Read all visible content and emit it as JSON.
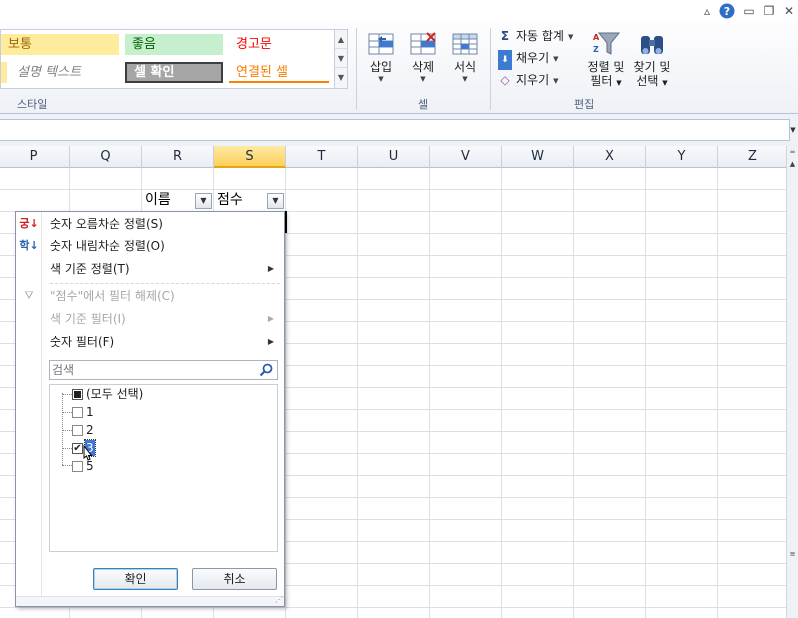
{
  "window_controls": {
    "help_icon": "?",
    "minimize_icon": "▭",
    "restore_icon": "❐",
    "close_icon": "✕",
    "collapse_icon": "▵"
  },
  "ribbon": {
    "styles": {
      "cells": [
        {
          "label": "보통",
          "bg": "#ffeb9c",
          "fg": "#9c6500"
        },
        {
          "label": "좋음",
          "bg": "#c6efce",
          "fg": "#006100"
        },
        {
          "label": "경고문",
          "bg": "#ffffff",
          "fg": "#ff0000"
        },
        {
          "label": "설명 텍스트",
          "bg": "#ffffff",
          "fg": "#7f7f7f"
        },
        {
          "label": "셀 확인",
          "bg": "#a5a5a5",
          "fg": "#ffffff"
        },
        {
          "label": "연결된 셀",
          "bg": "#ffffff",
          "fg": "#fa7d00"
        }
      ],
      "group_label": "스타일"
    },
    "cells_group": {
      "insert_label": "삽입",
      "delete_label": "삭제",
      "format_label": "서식",
      "group_label": "셀"
    },
    "editing": {
      "autosum_label": "자동 합계",
      "fill_label": "채우기",
      "clear_label": "지우기",
      "sort_filter_line1": "정렬 및",
      "sort_filter_line2": "필터",
      "find_select_line1": "찾기 및",
      "find_select_line2": "선택",
      "group_label": "편집"
    }
  },
  "grid": {
    "columns": [
      "P",
      "Q",
      "R",
      "S",
      "T",
      "U",
      "V",
      "W",
      "X",
      "Y",
      "Z"
    ],
    "selected_column": "S",
    "header_cells": {
      "name": "이름",
      "score": "점수"
    }
  },
  "filter_menu": {
    "sort_asc": "숫자 오름차순 정렬(S)",
    "sort_desc": "숫자 내림차순 정렬(O)",
    "sort_by_color": "색 기준 정렬(T)",
    "clear_filter": "\"점수\"에서 필터 해제(C)",
    "filter_by_color": "색 기준 필터(I)",
    "number_filters": "숫자 필터(F)",
    "search_placeholder": "검색",
    "list_items": [
      {
        "label": "(모두 선택)",
        "state": "partial"
      },
      {
        "label": "1",
        "state": "unchecked"
      },
      {
        "label": "2",
        "state": "unchecked"
      },
      {
        "label": "3",
        "state": "checked",
        "highlighted": true
      },
      {
        "label": "5",
        "state": "unchecked"
      }
    ],
    "ok_label": "확인",
    "cancel_label": "취소"
  }
}
